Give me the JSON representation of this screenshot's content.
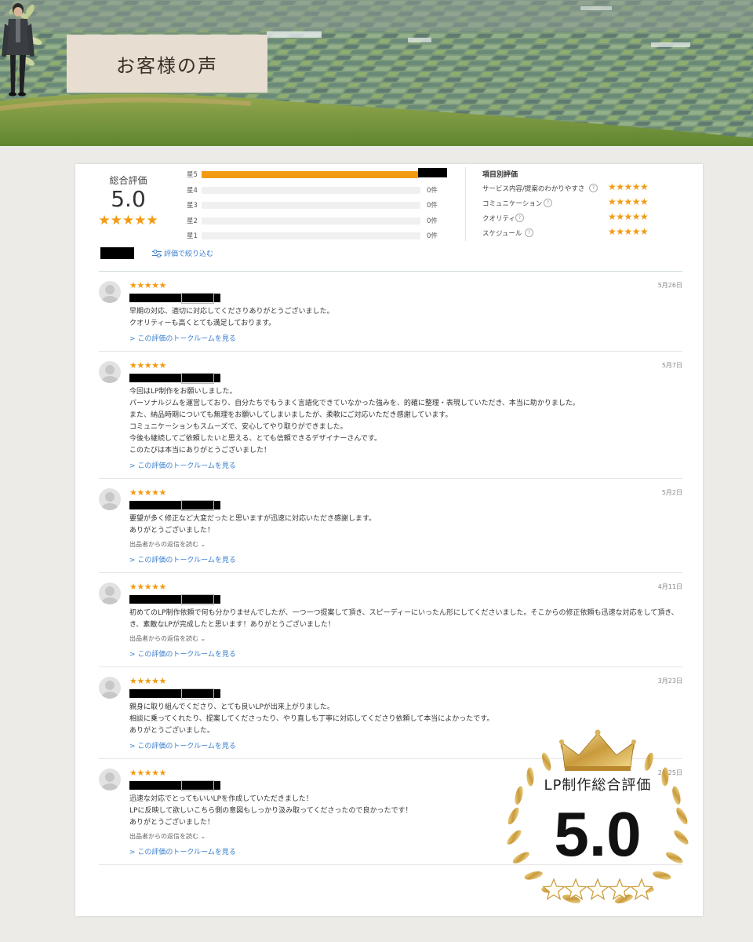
{
  "header": {
    "title": "お客様の声"
  },
  "summary": {
    "overall_label": "総合評価",
    "overall_score": "5.0",
    "stars": "★★★★★",
    "bars": [
      {
        "label": "星5",
        "fill": 0.99,
        "count": ""
      },
      {
        "label": "星4",
        "fill": 0,
        "count": "0件"
      },
      {
        "label": "星3",
        "fill": 0,
        "count": "0件"
      },
      {
        "label": "星2",
        "fill": 0,
        "count": "0件"
      },
      {
        "label": "星1",
        "fill": 0,
        "count": "0件"
      }
    ],
    "criteria_title": "項目別評価",
    "criteria": [
      {
        "label": "サービス内容/提案のわかりやすさ",
        "stars": "★★★★★"
      },
      {
        "label": "コミュニケーション",
        "stars": "★★★★★"
      },
      {
        "label": "クオリティ",
        "stars": "★★★★★"
      },
      {
        "label": "スケジュール",
        "stars": "★★★★★"
      }
    ],
    "help_icon": "?",
    "filter_label": "評価で絞り込む"
  },
  "reviews": [
    {
      "date": "5月26日",
      "stars": "★★★★★",
      "lines": [
        "早期の対応、適切に対応してくださりありがとうございました。",
        "クオリティーも高くとても満足しております。"
      ],
      "reply": "",
      "link": "> この評価のトークルームを見る"
    },
    {
      "date": "5月7日",
      "stars": "★★★★★",
      "lines": [
        "今回はLP制作をお願いしました。",
        "パーソナルジムを運営しており、自分たちでもうまく言語化できていなかった強みを、的確に整理・表現していただき、本当に助かりました。",
        "また、納品時期についても無理をお願いしてしまいましたが、柔軟にご対応いただき感謝しています。",
        "コミュニケーションもスムーズで、安心してやり取りができました。",
        "今後も継続してご依頼したいと思える、とても信頼できるデザイナーさんです。",
        "このたびは本当にありがとうございました！"
      ],
      "reply": "",
      "link": "> この評価のトークルームを見る"
    },
    {
      "date": "5月2日",
      "stars": "★★★★★",
      "lines": [
        "要望が多く修正など大変だったと思いますが迅速に対応いただき感謝します。",
        "ありがとうございました！"
      ],
      "reply": "出品者からの返信を読む ⌄",
      "link": "> この評価のトークルームを見る"
    },
    {
      "date": "4月11日",
      "stars": "★★★★★",
      "lines": [
        "初めてのLP制作依頼で何も分かりませんでしたが、一つ一つ提案して頂き、スピーディーにいったん形にしてくださいました。そこからの修正依頼も迅速な対応をして頂き、",
        "き、素敵なLPが完成したと思います！ありがとうございました！"
      ],
      "reply": "出品者からの返信を読む ⌄",
      "link": "> この評価のトークルームを見る"
    },
    {
      "date": "3月23日",
      "stars": "★★★★★",
      "lines": [
        "親身に取り組んでくださり、とても良いLPが出来上がりました。",
        "相談に乗ってくれたり、提案してくださったり、やり直しも丁寧に対応してくださり依頼して本当によかったです。",
        "ありがとうございました。"
      ],
      "reply": "",
      "link": "> この評価のトークルームを見る"
    },
    {
      "date": "2月25日",
      "stars": "★★★★★",
      "lines": [
        "迅速な対応でとってもいいLPを作成していただきました！",
        "LPに反映して欲しいこちら側の意図もしっかり汲み取ってくださったので良かったです！",
        "ありがとうございました！"
      ],
      "reply": "出品者からの返信を読む ⌄",
      "link": "> この評価のトークルームを見る"
    }
  ],
  "badge": {
    "title": "LP制作総合評価",
    "score": "5.0"
  },
  "colors": {
    "accent": "#f29b12",
    "link": "#3b7fcc"
  }
}
